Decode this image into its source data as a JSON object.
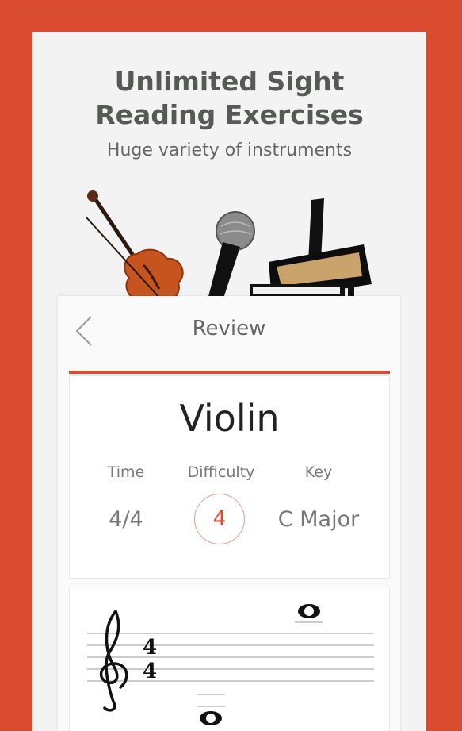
{
  "promo": {
    "headline_line1": "Unlimited Sight",
    "headline_line2": "Reading Exercises",
    "subhead": "Huge variety of instruments"
  },
  "nav": {
    "title": "Review",
    "back_icon": "chevron-left-icon"
  },
  "exercise": {
    "instrument": "Violin",
    "time_label": "Time",
    "time_value": "4/4",
    "difficulty_label": "Difficulty",
    "difficulty_value": "4",
    "key_label": "Key",
    "key_value": "C Major"
  },
  "score": {
    "clef": "treble-clef-icon",
    "time_signature_top": "4",
    "time_signature_bottom": "4"
  },
  "colors": {
    "accent": "#d94b2f",
    "background": "#f3f3f3"
  }
}
